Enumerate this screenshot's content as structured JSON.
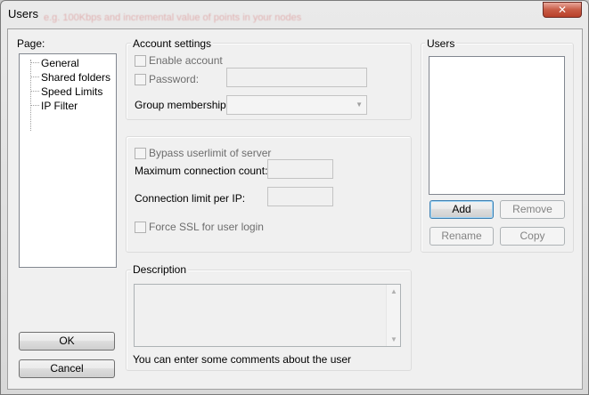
{
  "window": {
    "title": "Users",
    "close_glyph": "✕",
    "background_text": "e.g. 100Kbps and incremental value of points in your nodes"
  },
  "page_panel": {
    "label": "Page:",
    "items": [
      "General",
      "Shared folders",
      "Speed Limits",
      "IP Filter"
    ]
  },
  "account_settings": {
    "title": "Account settings",
    "enable_account": "Enable account",
    "password_label": "Password:",
    "password_value": "",
    "group_membership_label": "Group membership:",
    "group_membership_value": ""
  },
  "limits": {
    "bypass_label": "Bypass userlimit of server",
    "max_conn_label": "Maximum connection count:",
    "max_conn_value": "",
    "conn_per_ip_label": "Connection limit per IP:",
    "conn_per_ip_value": "",
    "force_ssl_label": "Force SSL for user login"
  },
  "description": {
    "title": "Description",
    "value": "",
    "hint": "You can enter some comments about the user"
  },
  "users": {
    "title": "Users",
    "items": [],
    "add": "Add",
    "remove": "Remove",
    "rename": "Rename",
    "copy": "Copy"
  },
  "buttons": {
    "ok": "OK",
    "cancel": "Cancel"
  },
  "colors": {
    "close_button": "#c85b45",
    "default_button_border": "#3c7fb1"
  }
}
